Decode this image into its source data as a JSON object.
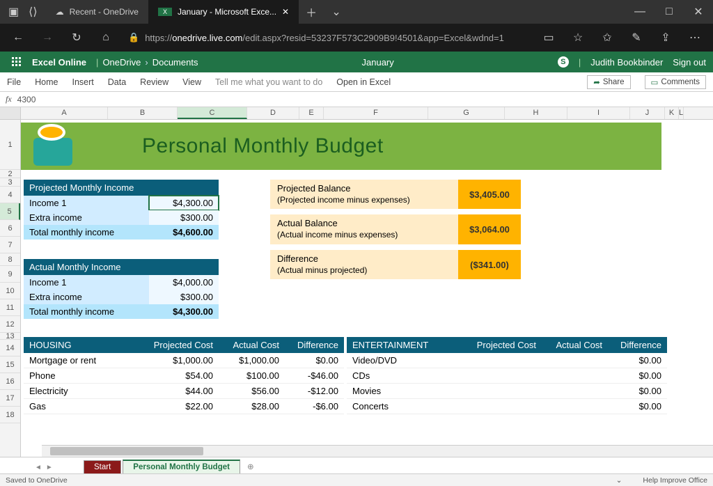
{
  "titlebar": {
    "tab1": "Recent - OneDrive",
    "tab2": "January - Microsoft Exce..."
  },
  "addr": {
    "scheme": "https://",
    "host": "onedrive.live.com",
    "path": "/edit.aspx?resid=53237F573C2909B9!4501&app=Excel&wdnd=1"
  },
  "xl": {
    "brand": "Excel Online",
    "bc1": "OneDrive",
    "bc2": "Documents",
    "docname": "January",
    "user": "Judith Bookbinder",
    "signout": "Sign out"
  },
  "ribbon": {
    "file": "File",
    "home": "Home",
    "insert": "Insert",
    "data": "Data",
    "review": "Review",
    "view": "View",
    "tellme": "Tell me what you want to do",
    "openin": "Open in Excel",
    "share": "Share",
    "comments": "Comments"
  },
  "fx": {
    "label": "fx",
    "value": "4300"
  },
  "cols": [
    "A",
    "B",
    "C",
    "D",
    "E",
    "F",
    "G",
    "H",
    "I",
    "J",
    "K",
    "L"
  ],
  "rows": [
    "1",
    "2",
    "3",
    "4",
    "5",
    "6",
    "7",
    "8",
    "9",
    "10",
    "11",
    "12",
    "13",
    "14",
    "15",
    "16",
    "17",
    "18"
  ],
  "banner_title": "Personal Monthly Budget",
  "proj_income": {
    "header": "Projected Monthly Income",
    "r1l": "Income 1",
    "r1v": "$4,300.00",
    "r2l": "Extra income",
    "r2v": "$300.00",
    "r3l": "Total monthly income",
    "r3v": "$4,600.00"
  },
  "act_income": {
    "header": "Actual Monthly Income",
    "r1l": "Income 1",
    "r1v": "$4,000.00",
    "r2l": "Extra income",
    "r2v": "$300.00",
    "r3l": "Total monthly income",
    "r3v": "$4,300.00"
  },
  "balances": {
    "b1t": "Projected Balance",
    "b1s": "(Projected income minus expenses)",
    "b1v": "$3,405.00",
    "b2t": "Actual Balance",
    "b2s": "(Actual income minus expenses)",
    "b2v": "$3,064.00",
    "b3t": "Difference",
    "b3s": "(Actual minus projected)",
    "b3v": "($341.00)"
  },
  "housing": {
    "h": "HOUSING",
    "pc": "Projected Cost",
    "ac": "Actual Cost",
    "df": "Difference",
    "rows": [
      {
        "n": "Mortgage or rent",
        "p": "$1,000.00",
        "a": "$1,000.00",
        "d": "$0.00"
      },
      {
        "n": "Phone",
        "p": "$54.00",
        "a": "$100.00",
        "d": "-$46.00"
      },
      {
        "n": "Electricity",
        "p": "$44.00",
        "a": "$56.00",
        "d": "-$12.00"
      },
      {
        "n": "Gas",
        "p": "$22.00",
        "a": "$28.00",
        "d": "-$6.00"
      }
    ]
  },
  "ent": {
    "h": "ENTERTAINMENT",
    "pc": "Projected Cost",
    "ac": "Actual Cost",
    "df": "Difference",
    "rows": [
      {
        "n": "Video/DVD",
        "p": "",
        "a": "",
        "d": "$0.00"
      },
      {
        "n": "CDs",
        "p": "",
        "a": "",
        "d": "$0.00"
      },
      {
        "n": "Movies",
        "p": "",
        "a": "",
        "d": "$0.00"
      },
      {
        "n": "Concerts",
        "p": "",
        "a": "",
        "d": "$0.00"
      }
    ]
  },
  "sheets": {
    "s1": "Start",
    "s2": "Personal Monthly Budget"
  },
  "status": {
    "saved": "Saved to OneDrive",
    "hio": "Help Improve Office"
  }
}
